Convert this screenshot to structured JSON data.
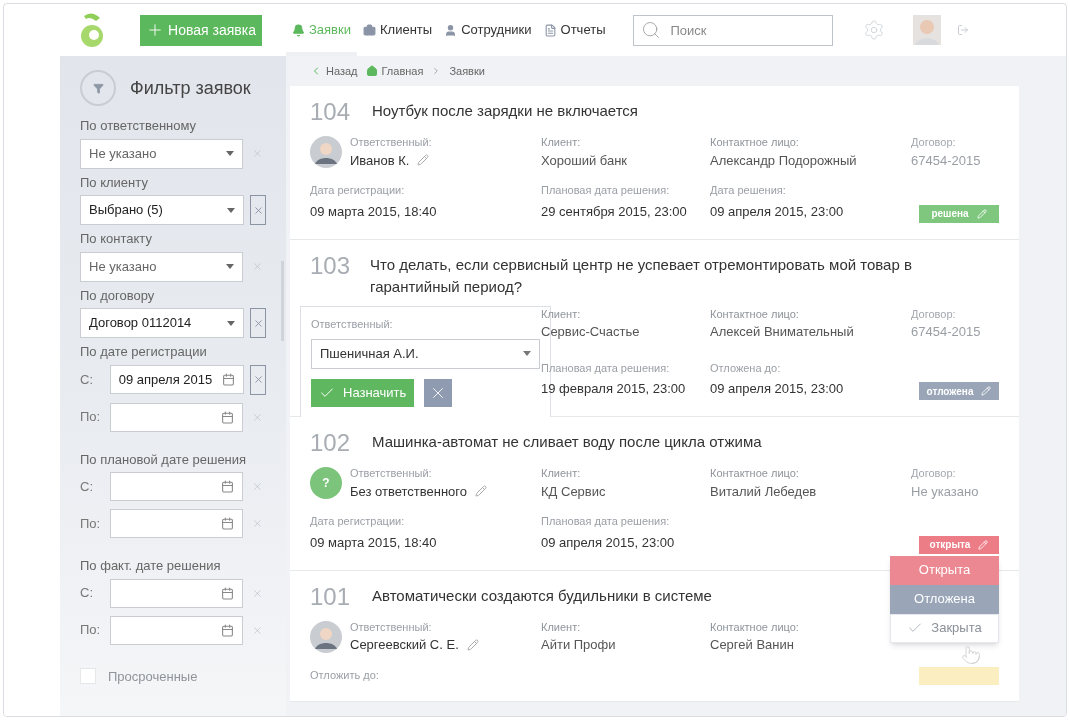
{
  "header": {
    "new_button": "Новая заявка",
    "nav": [
      {
        "label": "Заявки",
        "selected": true
      },
      {
        "label": "Клиенты",
        "selected": false
      },
      {
        "label": "Сотрудники",
        "selected": false
      },
      {
        "label": "Отчеты",
        "selected": false
      }
    ],
    "search": {
      "placeholder": "Поиск"
    }
  },
  "sidebar": {
    "title": "Фильтр заявок",
    "filters": [
      {
        "kind": "select",
        "label": "По ответственному",
        "placeholder": "Не указано",
        "clearable": false
      },
      {
        "kind": "select",
        "label": "По клиенту",
        "value": "Выбрано  (5)",
        "clearable": true
      },
      {
        "kind": "select",
        "label": "По контакту",
        "placeholder": "Не указано",
        "clearable": false
      },
      {
        "kind": "select",
        "label": "По договору",
        "value": "Договор 0112014",
        "clearable": true
      },
      {
        "kind": "dates",
        "label": "По дате регистрации",
        "rows": [
          {
            "prefix": "С:",
            "value": "09 апреля 2015",
            "clearable": true
          },
          {
            "prefix": "По:",
            "clearable": false
          }
        ]
      },
      {
        "kind": "dates",
        "label": "По плановой дате решения",
        "rows": [
          {
            "prefix": "С:",
            "clearable": false
          },
          {
            "prefix": "По:",
            "clearable": false
          }
        ]
      },
      {
        "kind": "dates",
        "label": "По факт. дате решения",
        "rows": [
          {
            "prefix": "С:",
            "clearable": false
          },
          {
            "prefix": "По:",
            "clearable": false
          }
        ]
      },
      {
        "kind": "checkbox",
        "label": "Просроченные",
        "checked": false
      }
    ]
  },
  "breadcrumbs": [
    "Назад",
    "Главная",
    "Заявки"
  ],
  "tickets": [
    {
      "number": "104",
      "title": "Ноутбук после зарядки не включается",
      "assignee": {
        "kind": "photo",
        "label": "Ответственный:",
        "name": "Иванов К."
      },
      "client": {
        "label": "Клиент:",
        "value": "Хороший банк"
      },
      "contact": {
        "label": "Контактное лицо:",
        "value": "Александр Подорожный"
      },
      "contract": {
        "label": "Договор:",
        "value": "67454-2015"
      },
      "dates": [
        {
          "label": "Дата регистрации:",
          "value": "09 марта 2015, 18:40"
        },
        {
          "label": "Плановая дата решения:",
          "value": "29 сентября 2015, 23:00"
        },
        {
          "label": "Дата решения:",
          "value": "09 апреля 2015, 23:00"
        }
      ],
      "status": {
        "kind": "resolved",
        "label": "решена"
      }
    },
    {
      "number": "103",
      "title": "Что делать, если сервисный центр не успевает отремонтировать мой товар в гарантийный период?",
      "assignee": {
        "kind": "editor",
        "label": "Ответственный:",
        "name": "Пшеничная А.И.",
        "button": "Назначить"
      },
      "client": {
        "label": "Клиент:",
        "value": "Сервис-Счастье"
      },
      "contact": {
        "label": "Контактное лицо:",
        "value": "Алексей Внимательный"
      },
      "contract": {
        "label": "Договор:",
        "value": "67454-2015"
      },
      "dates": [
        {
          "label": "Плановая дата решения:",
          "value": "19 февраля 2015, 23:00"
        },
        {
          "label": "Отложена до:",
          "value": "09 апреля 2015, 23:00"
        }
      ],
      "status": {
        "kind": "postponed",
        "label": "отложена"
      }
    },
    {
      "number": "102",
      "title": "Машинка-автомат не сливает воду после цикла отжима",
      "assignee": {
        "kind": "unknown",
        "label": "Ответственный:",
        "name": "Без ответственного",
        "avatar_text": "?"
      },
      "client": {
        "label": "Клиент:",
        "value": "КД Сервис"
      },
      "contact": {
        "label": "Контактное лицо:",
        "value": "Виталий Лебедев"
      },
      "contract": {
        "label": "Договор:",
        "value": "Не указано"
      },
      "dates": [
        {
          "label": "Дата регистрации:",
          "value": "09 марта 2015, 18:40"
        },
        {
          "label": "Плановая дата решения:",
          "value": "09 апреля 2015, 23:00"
        }
      ],
      "status": {
        "kind": "open",
        "label": "открыта"
      },
      "status_menu": [
        {
          "label": "Открыта",
          "kind": "open",
          "selected": false
        },
        {
          "label": "Отложена",
          "kind": "postponed",
          "selected": false
        },
        {
          "label": "Закрыта",
          "kind": "closed",
          "selected": true
        }
      ]
    },
    {
      "number": "101",
      "title": "Автоматически создаются будильники в системе",
      "assignee": {
        "kind": "photo",
        "label": "Ответственный:",
        "name": "Сергеевский С. Е."
      },
      "client": {
        "label": "Клиент:",
        "value": "Айти Профи"
      },
      "contact": {
        "label": "Контактное лицо:",
        "value": "Сергей Ванин"
      },
      "dates": [
        {
          "label": "Отложить до:"
        }
      ],
      "status": {
        "kind": "new"
      }
    }
  ]
}
